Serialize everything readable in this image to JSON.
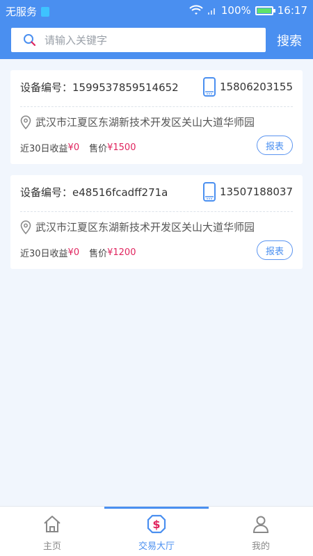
{
  "status": {
    "carrier": "无服务",
    "battery": "100%",
    "battery_fraction": 1.0,
    "time": "16:17"
  },
  "search": {
    "placeholder": "请输入关键字",
    "button": "搜索"
  },
  "devices": [
    {
      "label": "设备编号：",
      "id": "1599537859514652",
      "phone": "15806203155",
      "address": "武汉市江夏区东湖新技术开发区关山大道华师园",
      "income_label": "近30日收益",
      "income": "¥0",
      "price_label": "售价",
      "price": "¥1500",
      "report": "报表"
    },
    {
      "label": "设备编号：",
      "id": "e48516fcadff271a",
      "phone": "13507188037",
      "address": "武汉市江夏区东湖新技术开发区关山大道华师园",
      "income_label": "近30日收益",
      "income": "¥0",
      "price_label": "售价",
      "price": "¥1200",
      "report": "报表"
    }
  ],
  "nav": {
    "items": [
      {
        "label": "主页",
        "icon": "home-icon"
      },
      {
        "label": "交易大厅",
        "icon": "dollar-icon"
      },
      {
        "label": "我的",
        "icon": "user-icon"
      }
    ],
    "active": 1
  },
  "colors": {
    "accent": "#4a8ff0",
    "price": "#e0245e",
    "background": "#f1f6fd"
  }
}
